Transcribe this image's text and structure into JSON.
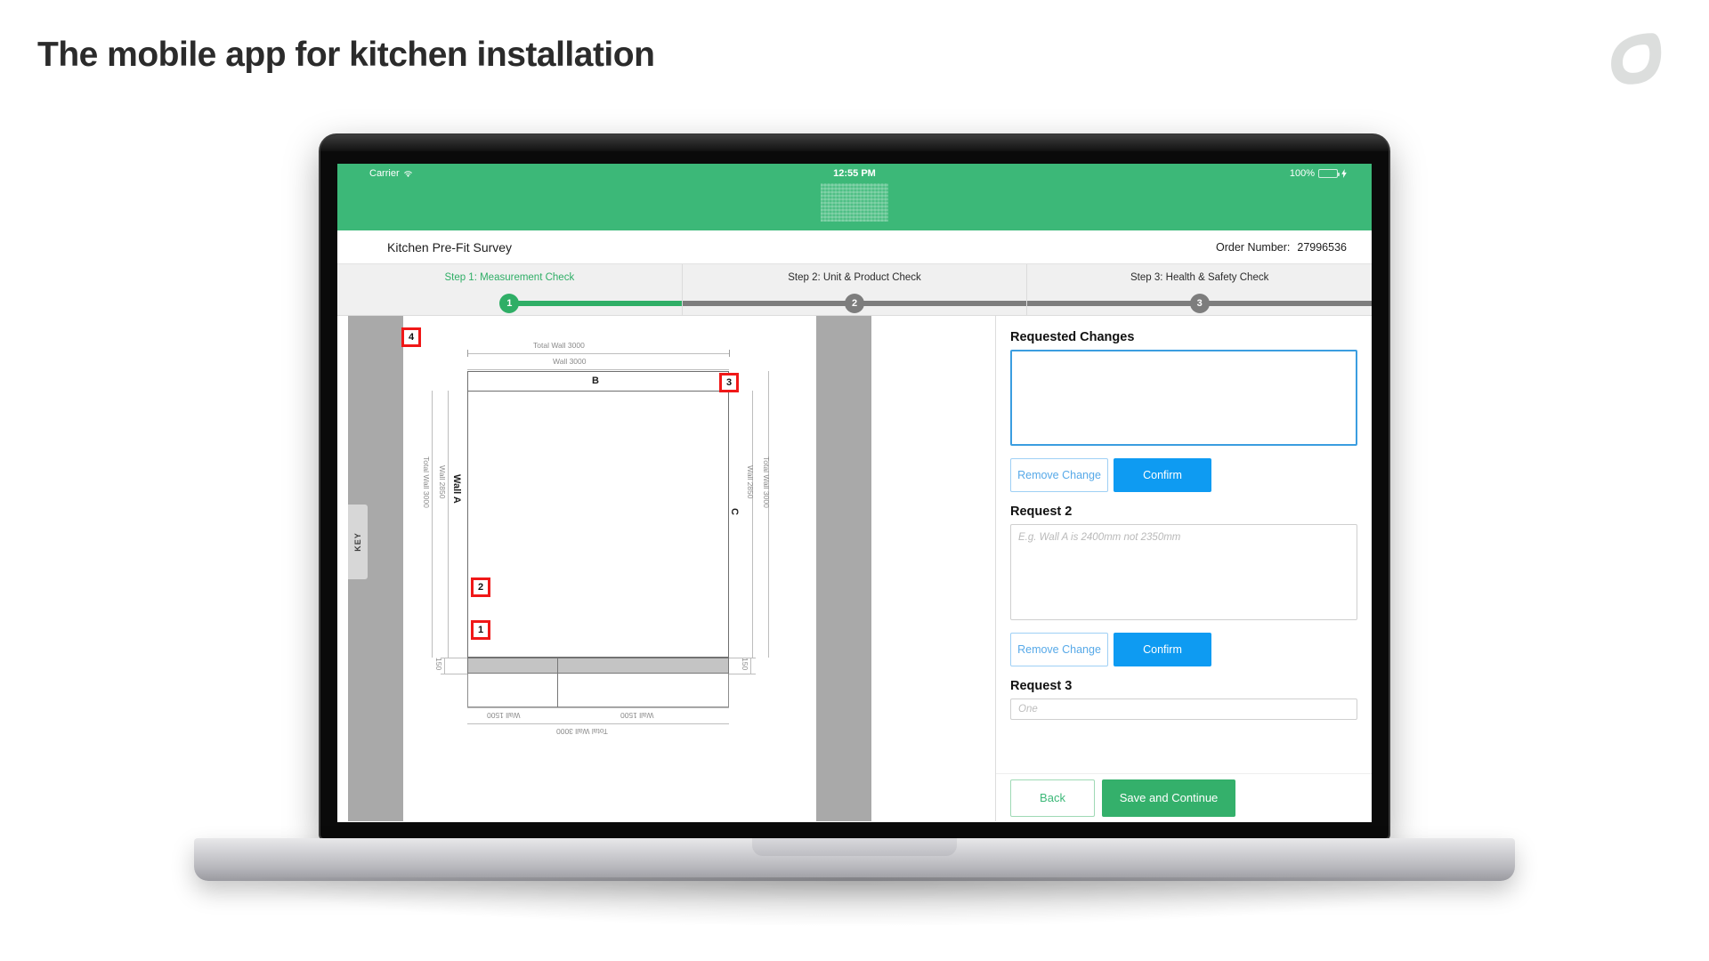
{
  "headline": "The mobile app for kitchen installation",
  "brand": {
    "logo_icon": "leaf-logo-icon",
    "logo_color": "#dcdedd"
  },
  "device": {
    "type": "laptop-mockup"
  },
  "status_bar": {
    "carrier": "Carrier",
    "wifi_icon": "wifi-icon",
    "time": "12:55 PM",
    "battery_percent": "100%",
    "battery_icon": "battery-icon",
    "charging_icon": "lightning-bolt-icon"
  },
  "header": {
    "brand_logo_icon": "app-brand-logo-icon",
    "survey_title": "Kitchen Pre-Fit Survey",
    "order_label": "Order Number:",
    "order_number": "27996536"
  },
  "stepper": {
    "active_index": 0,
    "steps": [
      {
        "label": "Step 1: Measurement Check",
        "number": "1",
        "state": "active"
      },
      {
        "label": "Step 2: Unit & Product Check",
        "number": "2",
        "state": "inactive"
      },
      {
        "label": "Step 3: Health & Safety Check",
        "number": "3",
        "state": "inactive"
      }
    ],
    "active_color": "#2fae66",
    "inactive_color": "#7d7d7d"
  },
  "plan": {
    "key_tab_label": "KEY",
    "wall_names": {
      "a": "Wall A",
      "b": "B",
      "c": "C"
    },
    "dimensions": {
      "top_total": "Total Wall 3000",
      "top_wall": "Wall 3000",
      "left_total": "Total Wall 3000",
      "left_wall": "Wall 2850",
      "right_wall": "Wall 2850",
      "right_total": "Total Wall 3000",
      "bottom_wall_left": "Wall 1500",
      "bottom_wall_right": "Wall 1500",
      "bottom_total": "Total Wall 3000",
      "depth_left": "150",
      "depth_right": "150"
    },
    "markers": [
      {
        "id": "1",
        "label": "1"
      },
      {
        "id": "2",
        "label": "2"
      },
      {
        "id": "3",
        "label": "3"
      },
      {
        "id": "4",
        "label": "4"
      }
    ],
    "marker_color": "#f01818"
  },
  "changes_panel": {
    "heading": "Requested Changes",
    "request1": {
      "value": "",
      "placeholder": "",
      "focused": true,
      "remove_label": "Remove Change",
      "confirm_label": "Confirm"
    },
    "request2": {
      "heading": "Request 2",
      "value": "",
      "placeholder": "E.g. Wall A is 2400mm not 2350mm",
      "remove_label": "Remove Change",
      "confirm_label": "Confirm"
    },
    "request3": {
      "heading": "Request 3",
      "value": "",
      "placeholder": "One"
    },
    "colors": {
      "confirm": "#0e9bf2",
      "remove_text": "#57a9e8",
      "focus_border": "#3b9de0"
    }
  },
  "footer": {
    "back_label": "Back",
    "save_label": "Save and Continue",
    "save_color": "#34b06b",
    "back_color": "#3cb878"
  }
}
